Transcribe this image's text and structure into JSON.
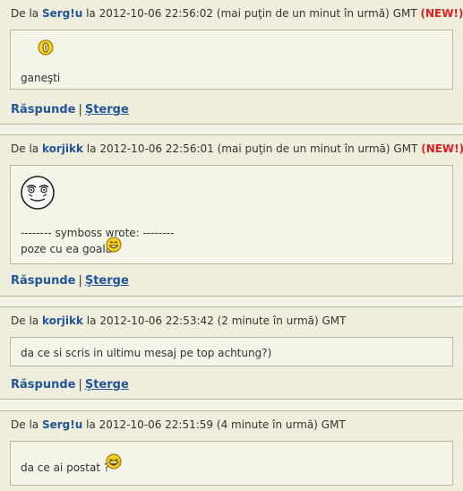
{
  "labels": {
    "from": "De la",
    "at": "la",
    "tz": "GMT",
    "new_open": "(",
    "new_close": ")",
    "new": "NEW!",
    "reply": "Răspunde",
    "delete": "Şterge",
    "sep": "|"
  },
  "posts": [
    {
      "user": "Serg!u",
      "date": "2012-10-06 22:56:02",
      "ago": "(mai puţin de un minut în urmă)",
      "is_new": true,
      "lines": [
        "ganeşti"
      ],
      "emoticon": "wink-smiley"
    },
    {
      "user": "korjikk",
      "date": "2012-10-06 22:56:01",
      "ago": "(mai puţin de un minut în urmă)",
      "is_new": true,
      "lines": [
        "-------- symboss wrote: --------",
        "poze cu ea goala"
      ],
      "emoticon": "me-gusta-face"
    },
    {
      "user": "korjikk",
      "date": "2012-10-06 22:53:42",
      "ago": "(2 minute în urmă)",
      "is_new": false,
      "lines": [
        "da ce si scris in ultimu mesaj pe top achtung?)"
      ]
    },
    {
      "user": "Serg!u",
      "date": "2012-10-06 22:51:59",
      "ago": "(4 minute în urmă)",
      "is_new": false,
      "lines": [
        "da ce ai postat ?"
      ],
      "emoticon": "laughing-smiley"
    }
  ]
}
